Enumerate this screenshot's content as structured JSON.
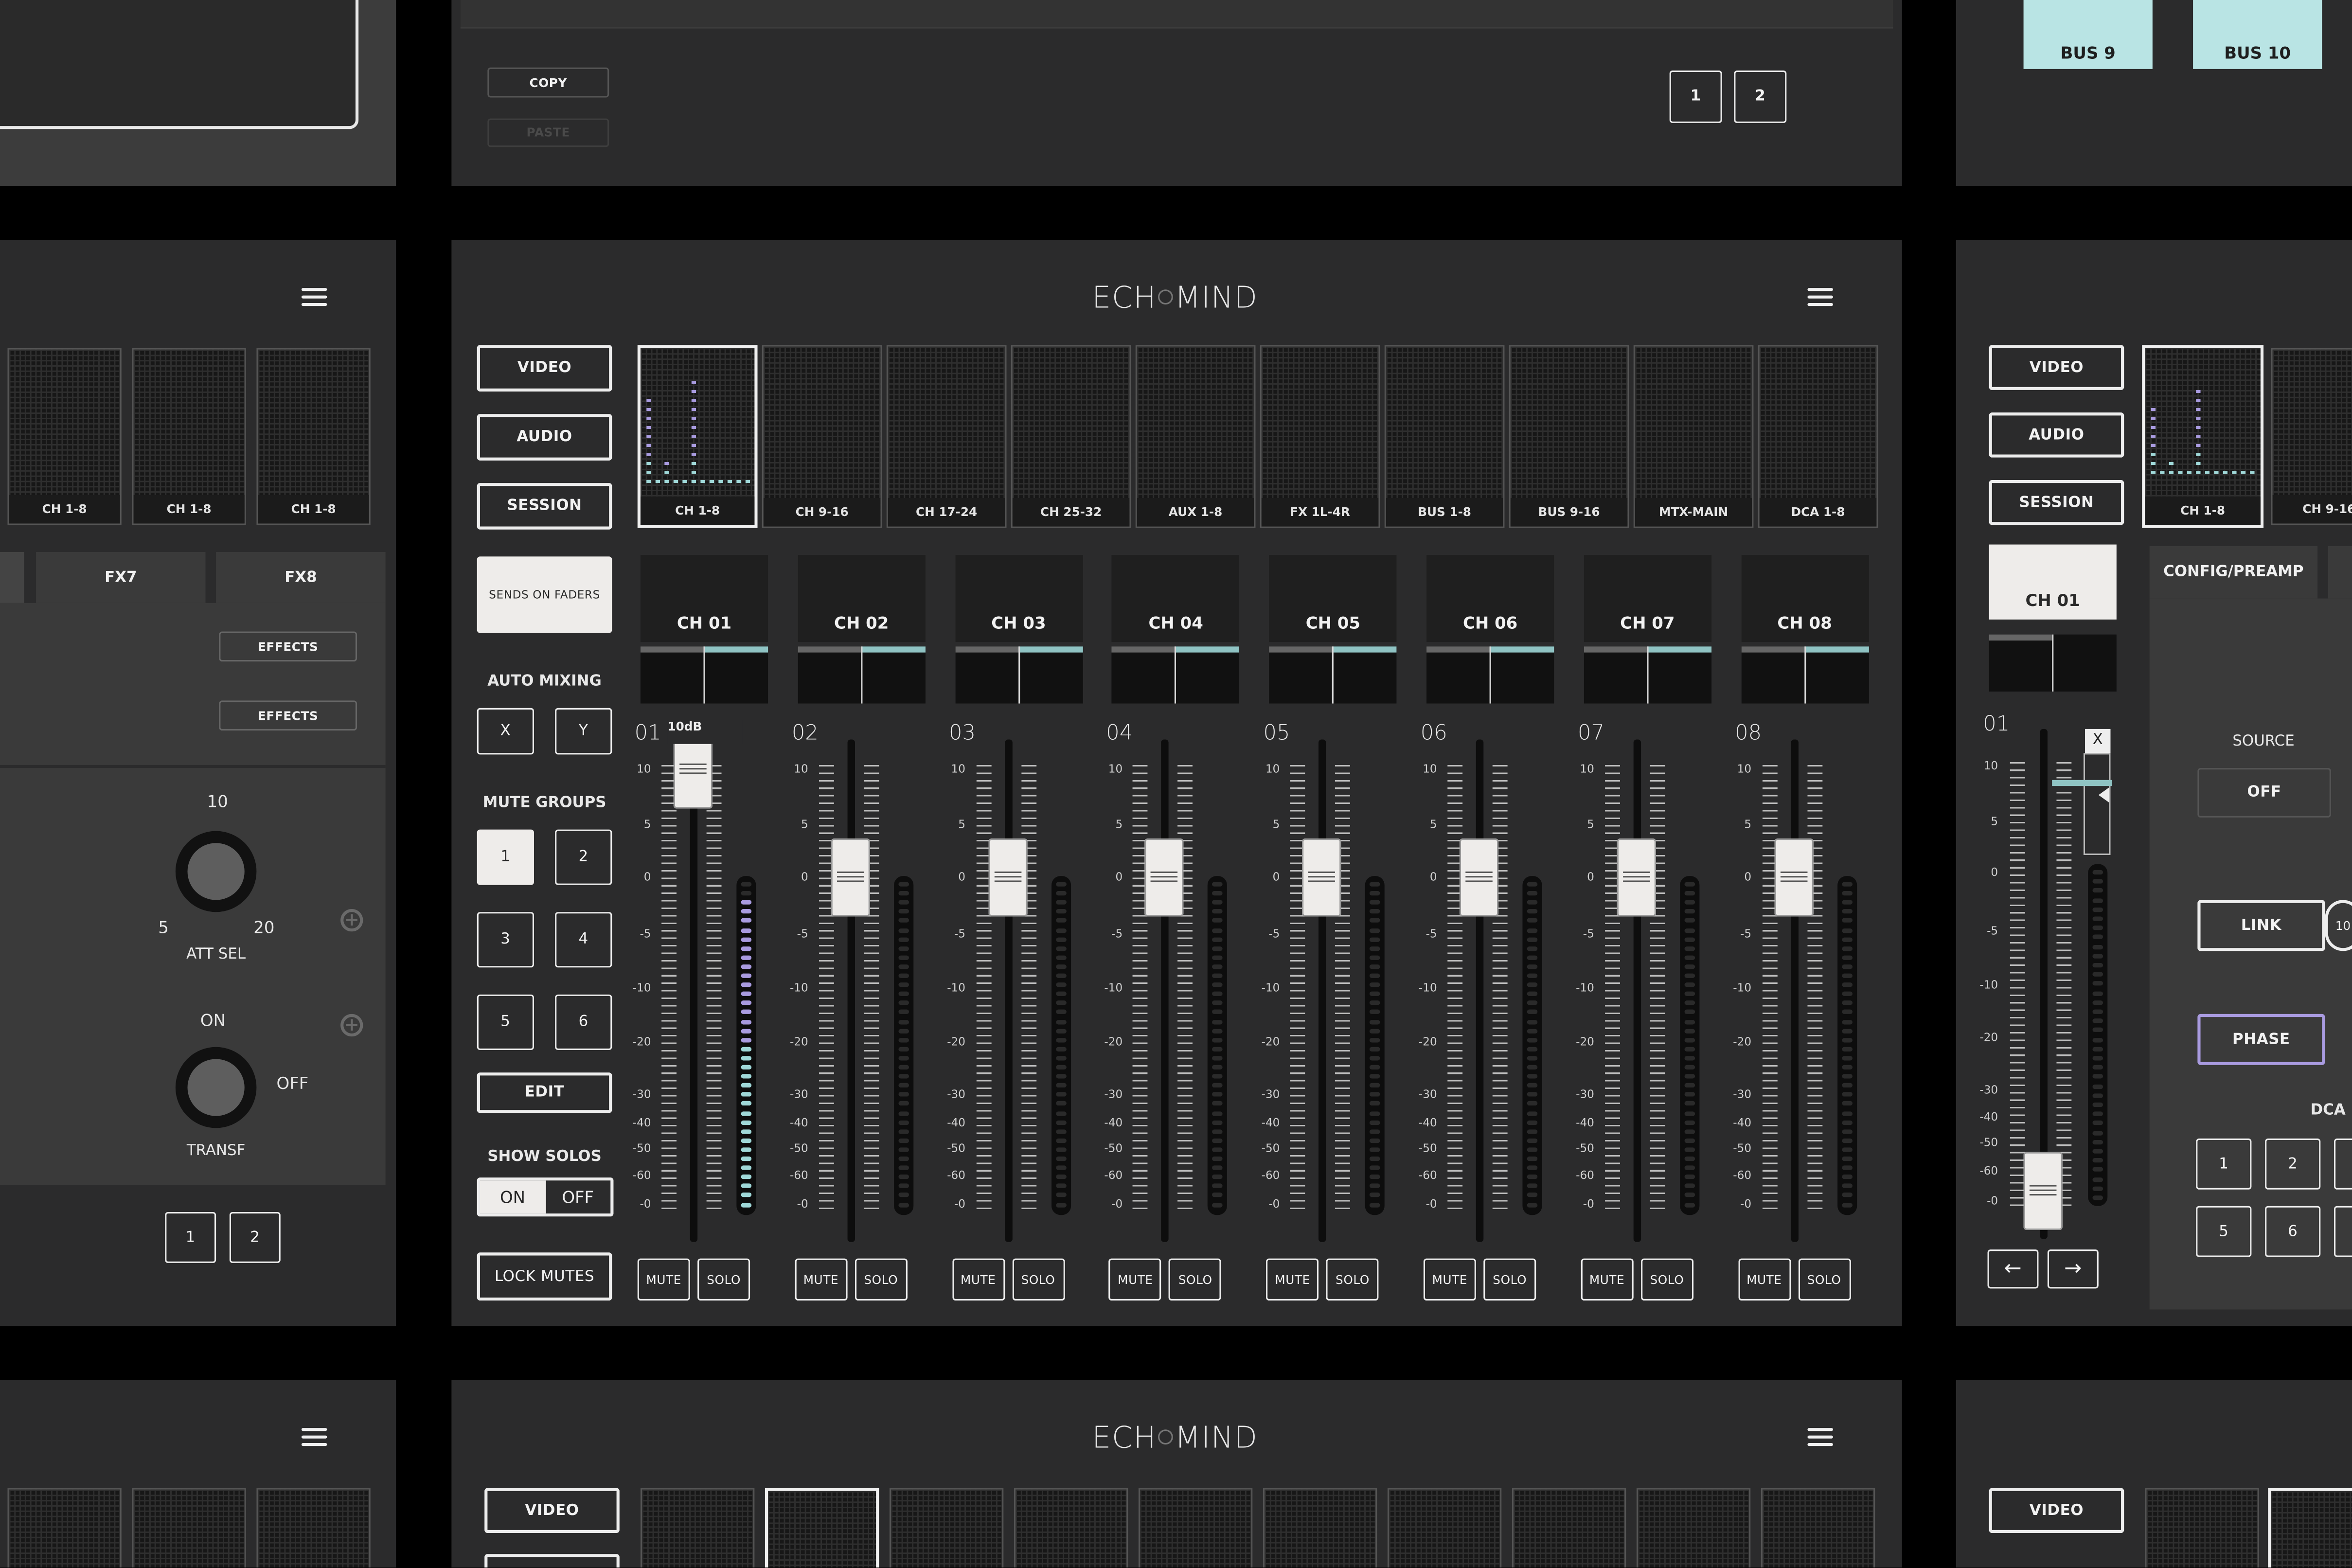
{
  "brand": {
    "logo_pre": "ECH",
    "logo_post": "MIND"
  },
  "colors": {
    "bg": "#2b2b2c",
    "accent": "#8fc3c3",
    "meter_purple": "#a99be0",
    "meter_cyan": "#9fd8d8",
    "white": "#eeecea"
  },
  "top_center": {
    "copy": "COPY",
    "paste": "PASTE",
    "page1": "1",
    "page2": "2"
  },
  "top_right": {
    "bus9": "BUS 9",
    "bus10": "BUS 10"
  },
  "nav": {
    "video": "VIDEO",
    "audio": "AUDIO",
    "session": "SESSION"
  },
  "layers": [
    {
      "label": "CH 1-8"
    },
    {
      "label": "CH 9-16"
    },
    {
      "label": "CH 17-24"
    },
    {
      "label": "CH 25-32"
    },
    {
      "label": "AUX 1-8"
    },
    {
      "label": "FX 1L-4R"
    },
    {
      "label": "BUS 1-8"
    },
    {
      "label": "BUS 9-16"
    },
    {
      "label": "MTX-MAIN"
    },
    {
      "label": "DCA 1-8"
    }
  ],
  "controls": {
    "sends_on_faders": "SENDS ON FADERS",
    "auto_mixing": "AUTO MIXING",
    "x": "X",
    "y": "Y",
    "mute_groups": "MUTE GROUPS",
    "groups": [
      "1",
      "2",
      "3",
      "4",
      "5",
      "6"
    ],
    "edit": "EDIT",
    "show_solos": "SHOW SOLOS",
    "on": "ON",
    "off": "OFF",
    "lock_mutes": "LOCK MUTES"
  },
  "channels": [
    {
      "name": "CH 01",
      "num": "01",
      "level_db": 10,
      "meter_level": 0.97
    },
    {
      "name": "CH 02",
      "num": "02",
      "level_db": 0,
      "meter_level": 0
    },
    {
      "name": "CH 03",
      "num": "03",
      "level_db": 0,
      "meter_level": 0
    },
    {
      "name": "CH 04",
      "num": "04",
      "level_db": 0,
      "meter_level": 0
    },
    {
      "name": "CH 05",
      "num": "05",
      "level_db": 0,
      "meter_level": 0
    },
    {
      "name": "CH 06",
      "num": "06",
      "level_db": 0,
      "meter_level": 0
    },
    {
      "name": "CH 07",
      "num": "07",
      "level_db": 0,
      "meter_level": 0
    },
    {
      "name": "CH 08",
      "num": "08",
      "level_db": 0,
      "meter_level": 0
    }
  ],
  "fader_tooltip": "10dB",
  "scale": [
    "10",
    "5",
    "0",
    "-5",
    "-10",
    "-20",
    "-30",
    "-40",
    "-50",
    "-60",
    "-0"
  ],
  "mute": "MUTE",
  "solo": "SOLO",
  "left_panel": {
    "layer_label": "CH 1-8",
    "fx7": "FX7",
    "fx8": "FX8",
    "effects": "EFFECTS",
    "att_top": "10",
    "att_left": "5",
    "att_right": "20",
    "att_sel": "ATT SEL",
    "transf_on": "ON",
    "transf_off": "OFF",
    "transf": "TRANSF",
    "p1": "1",
    "p2": "2"
  },
  "right_panel": {
    "ch": "CH 01",
    "num": "01",
    "close": "X",
    "config": "CONFIG/PREAMP",
    "source": "SOURCE",
    "source_off": "OFF",
    "link": "LINK",
    "link_val": "10",
    "phase": "PHASE",
    "dca": "DCA",
    "dca_btns": [
      "1",
      "2",
      "5",
      "6"
    ],
    "layer1": "CH 1-8",
    "layer2": "CH 9-16",
    "prev": "←",
    "next": "→"
  }
}
